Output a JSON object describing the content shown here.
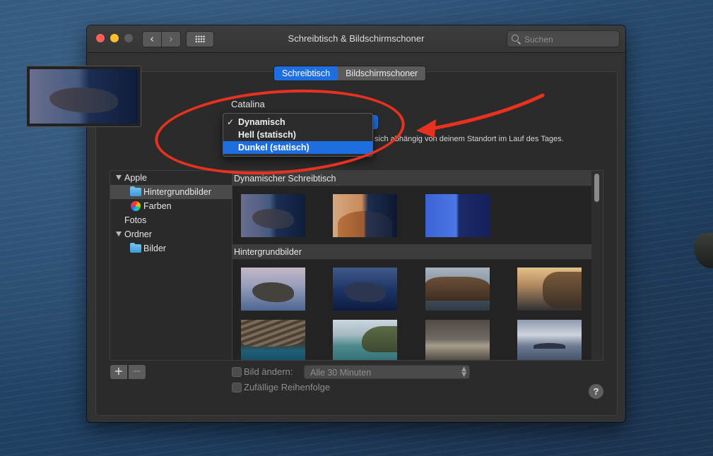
{
  "window": {
    "title": "Schreibtisch & Bildschirmschoner"
  },
  "toolbar": {
    "back_glyph": "‹",
    "forward_glyph": "›"
  },
  "search": {
    "placeholder": "Suchen"
  },
  "tabs": [
    {
      "label": "Schreibtisch",
      "active": true
    },
    {
      "label": "Bildschirmschoner",
      "active": false
    }
  ],
  "wallpaper": {
    "name": "Catalina",
    "description_visible": "sich abhängig von deinem Standort im Lauf des Tages."
  },
  "mode_menu": {
    "checkmark": "✓",
    "items": [
      {
        "label": "Dynamisch",
        "checked": true,
        "highlighted": false
      },
      {
        "label": "Hell (statisch)",
        "checked": false,
        "highlighted": false
      },
      {
        "label": "Dunkel (statisch)",
        "checked": false,
        "highlighted": true
      }
    ]
  },
  "sidebar": {
    "items": [
      {
        "label": "Apple",
        "kind": "group"
      },
      {
        "label": "Hintergrundbilder",
        "kind": "folder",
        "selected": true
      },
      {
        "label": "Farben",
        "kind": "colors"
      },
      {
        "label": "Fotos",
        "kind": "plain"
      },
      {
        "label": "Ordner",
        "kind": "group"
      },
      {
        "label": "Bilder",
        "kind": "folder"
      }
    ]
  },
  "gallery": {
    "sections": [
      {
        "title": "Dynamischer Schreibtisch",
        "thumbnails": [
          "catalina-dynamic",
          "mojave-dynamic",
          "solar-gradients"
        ]
      },
      {
        "title": "Hintergrundbilder",
        "thumbnails": [
          "catalina-day",
          "catalina-night",
          "coast-evening",
          "cliff-warm",
          "rocks-sea",
          "coast-teal",
          "storm",
          "clouds"
        ]
      }
    ]
  },
  "controls": {
    "add_glyph": "+",
    "remove_glyph": "−",
    "change_picture_label": "Bild ändern:",
    "change_picture_checked": false,
    "interval_value": "Alle 30 Minuten",
    "random_order_label": "Zufällige Reihenfolge",
    "random_order_checked": false,
    "help_glyph": "?"
  },
  "annotation": {
    "color": "#e8321f"
  },
  "colors": {
    "accent": "#1f6ee0",
    "window_bg": "#323232"
  }
}
